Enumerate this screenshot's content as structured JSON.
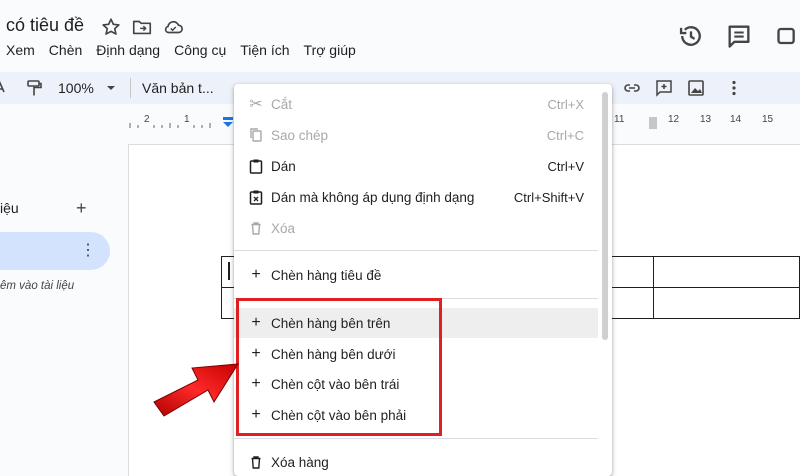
{
  "header": {
    "title": "có tiêu đề"
  },
  "menubar": {
    "items": [
      "Xem",
      "Chèn",
      "Định dạng",
      "Công cụ",
      "Tiện ích",
      "Trợ giúp"
    ]
  },
  "toolbar": {
    "zoom": "100%",
    "style": "Văn bản t..."
  },
  "ruler": {
    "numbers": [
      "2",
      "1",
      "11",
      "12",
      "13",
      "14",
      "15"
    ]
  },
  "outline": {
    "label": "iệu",
    "hint": "êm vào tài liệu"
  },
  "context_menu": {
    "items": [
      {
        "label": "Cắt",
        "shortcut": "Ctrl+X",
        "icon": "scissors-icon",
        "enabled": false
      },
      {
        "label": "Sao chép",
        "shortcut": "Ctrl+C",
        "icon": "copy-icon",
        "enabled": false
      },
      {
        "label": "Dán",
        "shortcut": "Ctrl+V",
        "icon": "clipboard-icon",
        "enabled": true
      },
      {
        "label": "Dán mà không áp dụng định dạng",
        "shortcut": "Ctrl+Shift+V",
        "icon": "clipboard-format-icon",
        "enabled": true
      },
      {
        "label": "Xóa",
        "shortcut": "",
        "icon": "trash-icon",
        "enabled": false
      },
      {
        "label": "Chèn hàng tiêu đề",
        "shortcut": "",
        "icon": "plus-icon",
        "enabled": true
      },
      {
        "label": "Chèn hàng bên trên",
        "shortcut": "",
        "icon": "plus-icon",
        "enabled": true
      },
      {
        "label": "Chèn hàng bên dưới",
        "shortcut": "",
        "icon": "plus-icon",
        "enabled": true
      },
      {
        "label": "Chèn cột vào bên trái",
        "shortcut": "",
        "icon": "plus-icon",
        "enabled": true
      },
      {
        "label": "Chèn cột vào bên phải",
        "shortcut": "",
        "icon": "plus-icon",
        "enabled": true
      },
      {
        "label": "Xóa hàng",
        "shortcut": "",
        "icon": "trash-icon",
        "enabled": true
      }
    ]
  },
  "annotation": {
    "color": "#e02020"
  }
}
